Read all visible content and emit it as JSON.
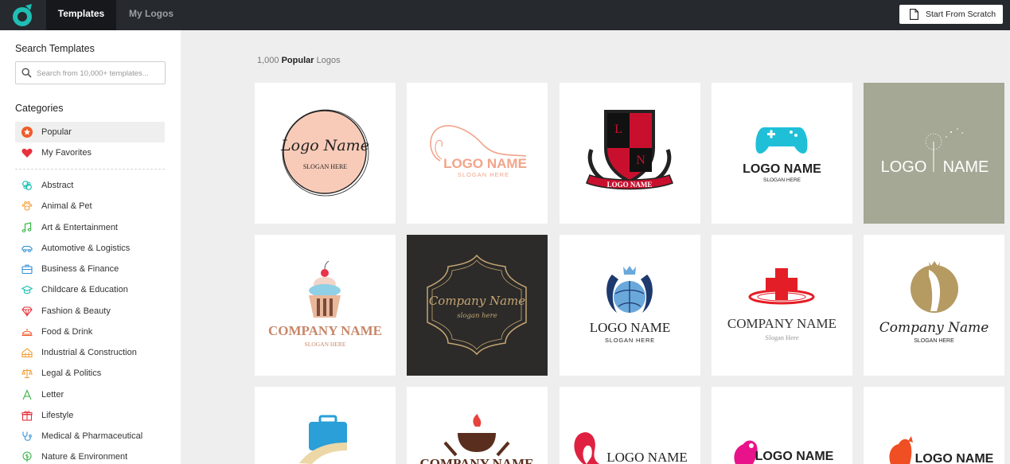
{
  "topbar": {
    "tabs": [
      {
        "label": "Templates"
      },
      {
        "label": "My Logos"
      }
    ],
    "scratch_label": "Start From Scratch",
    "brand_color": "#1fbfb4"
  },
  "sidebar": {
    "search_heading": "Search Templates",
    "search_placeholder": "Search from 10,000+ templates...",
    "categories_heading": "Categories",
    "pinned": [
      {
        "label": "Popular",
        "icon": "star-badge-icon",
        "active": true
      },
      {
        "label": "My Favorites",
        "icon": "heart-icon"
      }
    ],
    "categories": [
      {
        "label": "Abstract",
        "icon": "abstract-icon"
      },
      {
        "label": "Animal & Pet",
        "icon": "paw-icon"
      },
      {
        "label": "Art & Entertainment",
        "icon": "music-note-icon"
      },
      {
        "label": "Automotive & Logistics",
        "icon": "car-icon"
      },
      {
        "label": "Business & Finance",
        "icon": "briefcase-icon"
      },
      {
        "label": "Childcare & Education",
        "icon": "graduation-cap-icon"
      },
      {
        "label": "Fashion & Beauty",
        "icon": "diamond-icon"
      },
      {
        "label": "Food & Drink",
        "icon": "cloche-icon"
      },
      {
        "label": "Industrial & Construction",
        "icon": "factory-icon"
      },
      {
        "label": "Legal & Politics",
        "icon": "scales-icon"
      },
      {
        "label": "Letter",
        "icon": "letter-a-icon"
      },
      {
        "label": "Lifestyle",
        "icon": "gift-icon"
      },
      {
        "label": "Medical & Pharmaceutical",
        "icon": "stethoscope-icon"
      },
      {
        "label": "Nature & Environment",
        "icon": "leaf-icon"
      }
    ]
  },
  "main": {
    "count": "1,000",
    "filter": "Popular",
    "suffix": "Logos",
    "cards": [
      {
        "title": "Logo Name",
        "sub": "SLOGAN HERE"
      },
      {
        "title": "LOGO NAME",
        "sub": "SLOGAN HERE"
      },
      {
        "title": "LOGO NAME",
        "letters": [
          "L",
          "N"
        ]
      },
      {
        "title": "LOGO NAME",
        "sub": "SLOGAN HERE"
      },
      {
        "title": "LOGO",
        "title2": "NAME"
      },
      {
        "title": "COMPANY NAME",
        "sub": "SLOGAN HERE"
      },
      {
        "title": "Company Name",
        "sub": "slogan here"
      },
      {
        "title": "LOGO NAME",
        "sub": "SLOGAN HERE"
      },
      {
        "title": "COMPANY NAME",
        "sub": "Slogan Here"
      },
      {
        "title": "Company Name",
        "sub": "SLOGAN HERE"
      },
      {
        "title": ""
      },
      {
        "title": "COMPANY NAME"
      },
      {
        "title": "LOGO NAME"
      },
      {
        "title": "LOGO NAME"
      },
      {
        "title": "LOGO NAME"
      }
    ]
  }
}
